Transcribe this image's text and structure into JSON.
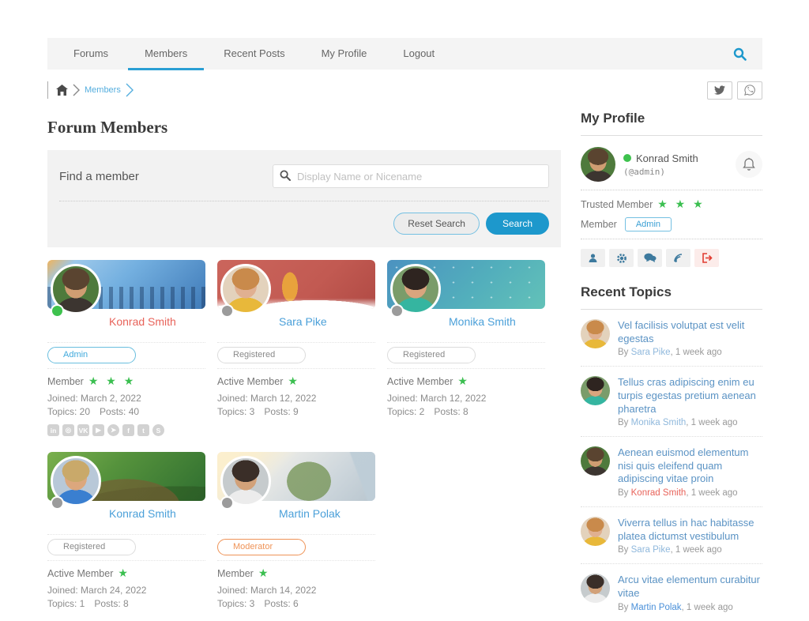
{
  "nav": {
    "items": [
      {
        "label": "Forums"
      },
      {
        "label": "Members"
      },
      {
        "label": "Recent Posts"
      },
      {
        "label": "My Profile"
      },
      {
        "label": "Logout"
      }
    ],
    "accent_color": "#2a9fd4"
  },
  "breadcrumb": {
    "current": "Members"
  },
  "page_title": "Forum Members",
  "member_search": {
    "label": "Find a member",
    "placeholder": "Display Name or Nicename",
    "reset_label": "Reset Search",
    "search_label": "Search"
  },
  "colors": {
    "star_green": "#3bbf50",
    "online_green": "#3ec24e",
    "offline_gray": "#9b9b9b",
    "admin_red": "#e8635a",
    "link_blue": "#4ba0d9",
    "moderator_orange": "#ef9357",
    "registered_gray": "#8a8a8a"
  },
  "members": [
    {
      "name": "Konrad Smith",
      "name_color": "#e8635a",
      "dot_color": "#3ec24e",
      "badge": "Admin",
      "badge_color": "#3fa9dc",
      "badge_border": "#69bede",
      "rank": "Member",
      "stars": "★ ★ ★",
      "joined": "Joined: March 2, 2022",
      "topics": "Topics: 20",
      "posts": "Posts: 40",
      "cover": [
        "#f0b35a 0%",
        "#9cc8ea 14%",
        "#74b0e0 45%",
        "#3f7ab8 100%"
      ],
      "avatar": {
        "hair": "#5a4430",
        "skin": "#cf9d72",
        "shirt": "#3c3530",
        "bg": "#4e7a3c"
      }
    },
    {
      "name": "Sara Pike",
      "name_color": "#4ba0d9",
      "dot_color": "#9b9b9b",
      "badge": "Registered",
      "badge_color": "#8a8a8a",
      "badge_border": "#dcdcdc",
      "rank": "Active Member",
      "stars": "★",
      "joined": "Joined: March 12, 2022",
      "topics": "Topics: 3",
      "posts": "Posts: 9",
      "cover": [
        "#cb655c 0%",
        "#c25a52 60%",
        "#b04a44 100%"
      ],
      "avatar": {
        "hair": "#c98a4b",
        "skin": "#e0b091",
        "shirt": "#e8b83a",
        "bg": "#e3d2bc"
      }
    },
    {
      "name": "Monika Smith",
      "name_color": "#4ba0d9",
      "dot_color": "#9b9b9b",
      "badge": "Registered",
      "badge_color": "#8a8a8a",
      "badge_border": "#dcdcdc",
      "rank": "Active Member",
      "stars": "★",
      "joined": "Joined: March 12, 2022",
      "topics": "Topics: 2",
      "posts": "Posts: 8",
      "cover": [
        "#4b92c0 0%",
        "#52aebc 55%",
        "#63c2b8 100%"
      ],
      "avatar": {
        "hair": "#2e2420",
        "skin": "#d9a57e",
        "shirt": "#35b5a0",
        "bg": "#7a9c6a"
      }
    },
    {
      "name": "Konrad Smith",
      "name_color": "#4ba0d9",
      "dot_color": "#9b9b9b",
      "badge": "Registered",
      "badge_color": "#8a8a8a",
      "badge_border": "#dcdcdc",
      "rank": "Active Member",
      "stars": "★",
      "joined": "Joined: March 24, 2022",
      "topics": "Topics: 1",
      "posts": "Posts: 8",
      "cover": [
        "#7ab04e 0%",
        "#55923c 40%",
        "#2f6e30 100%"
      ],
      "avatar": {
        "hair": "#c9a96a",
        "skin": "#dca77d",
        "shirt": "#3a7fd0",
        "bg": "#b8c8d8"
      }
    },
    {
      "name": "Martin Polak",
      "name_color": "#4ba0d9",
      "dot_color": "#9b9b9b",
      "badge": "Moderator",
      "badge_color": "#ef9357",
      "badge_border": "#ef9357",
      "rank": "Member",
      "stars": "★",
      "joined": "Joined: March 14, 2022",
      "topics": "Topics: 3",
      "posts": "Posts: 6",
      "cover": [
        "#f5edda 0%",
        "#e8e9e6 35%",
        "#cdd6dc 70%",
        "#b9c6cf 100%"
      ],
      "avatar": {
        "hair": "#3a2e28",
        "skin": "#d2a179",
        "shirt": "#ececec",
        "bg": "#c6cbcd"
      }
    }
  ],
  "social_icons": [
    {
      "name": "linkedin",
      "glyph": "in"
    },
    {
      "name": "instagram",
      "glyph": "◎"
    },
    {
      "name": "vk",
      "glyph": "VK"
    },
    {
      "name": "youtube",
      "glyph": "▶"
    },
    {
      "name": "telegram",
      "glyph": "➤"
    },
    {
      "name": "facebook",
      "glyph": "f"
    },
    {
      "name": "twitter",
      "glyph": "t"
    },
    {
      "name": "skype",
      "glyph": "S"
    }
  ],
  "profile": {
    "title": "My Profile",
    "name": "Konrad Smith",
    "nicename": "(@admin)",
    "rank_label": "Trusted Member",
    "stars": "★ ★ ★",
    "role_label": "Member",
    "role_badge": "Admin",
    "avatar": {
      "hair": "#5a4430",
      "skin": "#cf9d72",
      "shirt": "#3c3530",
      "bg": "#4e7a3c"
    }
  },
  "recent_topics": {
    "title": "Recent Topics",
    "items": [
      {
        "title": "Vel facilisis volutpat est velit egestas",
        "by": "By ",
        "author": "Sara Pike",
        "author_color": "#8fb8dc",
        "meta": ", 1 week ago",
        "avatar": {
          "hair": "#c98a4b",
          "skin": "#e0b091",
          "shirt": "#e8b83a",
          "bg": "#e3d2bc"
        }
      },
      {
        "title": "Tellus cras adipiscing enim eu turpis egestas pretium aenean pharetra",
        "by": "By ",
        "author": "Monika Smith",
        "author_color": "#8fb8dc",
        "meta": ", 1 week ago",
        "avatar": {
          "hair": "#2e2420",
          "skin": "#d9a57e",
          "shirt": "#35b5a0",
          "bg": "#7a9c6a"
        }
      },
      {
        "title": "Aenean euismod elementum nisi quis eleifend quam adipiscing vitae proin",
        "by": "By ",
        "author": "Konrad Smith",
        "author_color": "#e8635a",
        "meta": ", 1 week ago",
        "avatar": {
          "hair": "#5a4430",
          "skin": "#cf9d72",
          "shirt": "#3c3530",
          "bg": "#4e7a3c"
        }
      },
      {
        "title": "Viverra tellus in hac habitasse platea dictumst vestibulum",
        "by": "By ",
        "author": "Sara Pike",
        "author_color": "#8fb8dc",
        "meta": ", 1 week ago",
        "avatar": {
          "hair": "#c98a4b",
          "skin": "#e0b091",
          "shirt": "#e8b83a",
          "bg": "#e3d2bc"
        }
      },
      {
        "title": "Arcu vitae elementum curabitur vitae",
        "by": "By ",
        "author": "Martin Polak",
        "author_color": "#4a90d9",
        "meta": ", 1 week ago",
        "avatar": {
          "hair": "#3a2e28",
          "skin": "#d2a179",
          "shirt": "#ececec",
          "bg": "#c6cbcd"
        }
      }
    ]
  }
}
